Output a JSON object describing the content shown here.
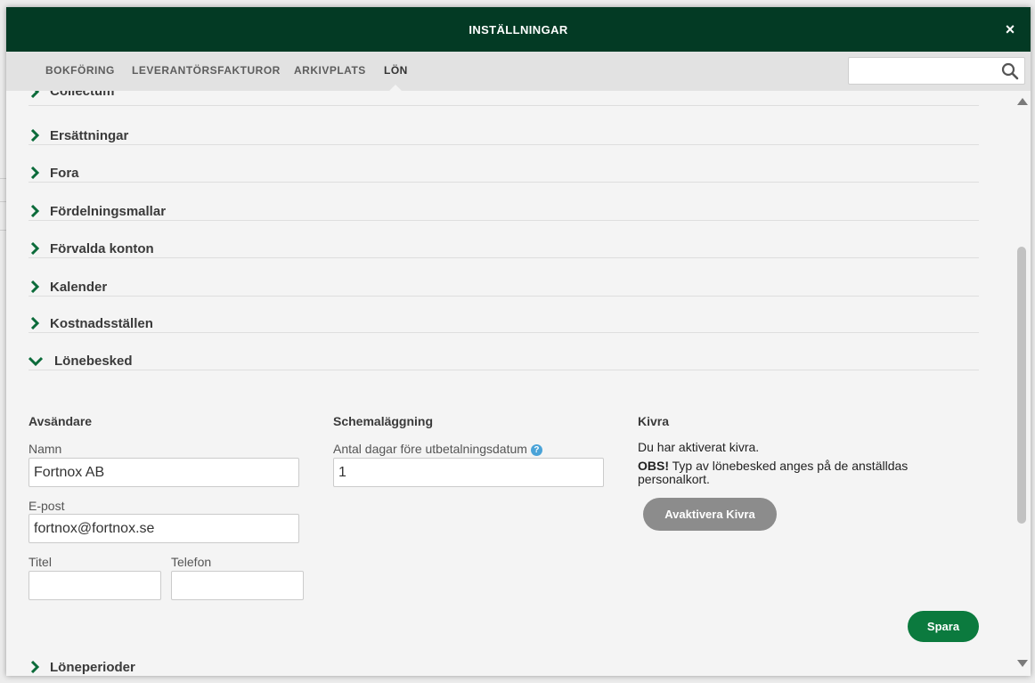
{
  "modal": {
    "title": "INSTÄLLNINGAR",
    "close_symbol": "×"
  },
  "tabs": [
    {
      "label": "BOKFÖRING"
    },
    {
      "label": "LEVERANTÖRSFAKTUROR"
    },
    {
      "label": "ARKIVPLATS"
    },
    {
      "label": "LÖN",
      "active": true
    }
  ],
  "search": {
    "value": "",
    "placeholder": ""
  },
  "accordion": [
    {
      "label": "Collectum"
    },
    {
      "label": "Ersättningar"
    },
    {
      "label": "Fora"
    },
    {
      "label": "Fördelningsmallar"
    },
    {
      "label": "Förvalda konton"
    },
    {
      "label": "Kalender"
    },
    {
      "label": "Kostnadsställen"
    },
    {
      "label": "Lönebesked",
      "expanded": true
    },
    {
      "label": "Löneperioder"
    }
  ],
  "lonebesked": {
    "sender": {
      "title": "Avsändare",
      "name_label": "Namn",
      "name_value": "Fortnox AB",
      "email_label": "E-post",
      "email_value": "fortnox@fortnox.se",
      "titel_label": "Titel",
      "titel_value": "",
      "phone_label": "Telefon",
      "phone_value": ""
    },
    "schedule": {
      "title": "Schemaläggning",
      "days_label": "Antal dagar före utbetalningsdatum",
      "days_value": "1",
      "help_symbol": "?"
    },
    "kivra": {
      "title": "Kivra",
      "status_text": "Du har aktiverat kivra.",
      "obs_label": "OBS!",
      "obs_text": "Typ av lönebesked anges på de anställdas personalkort.",
      "deactivate_label": "Avaktivera Kivra"
    },
    "save_label": "Spara"
  },
  "colors": {
    "header": "#033a24",
    "primary": "#0b7a3e",
    "chevron": "#0b6b3a",
    "help": "#4aa3d8"
  }
}
